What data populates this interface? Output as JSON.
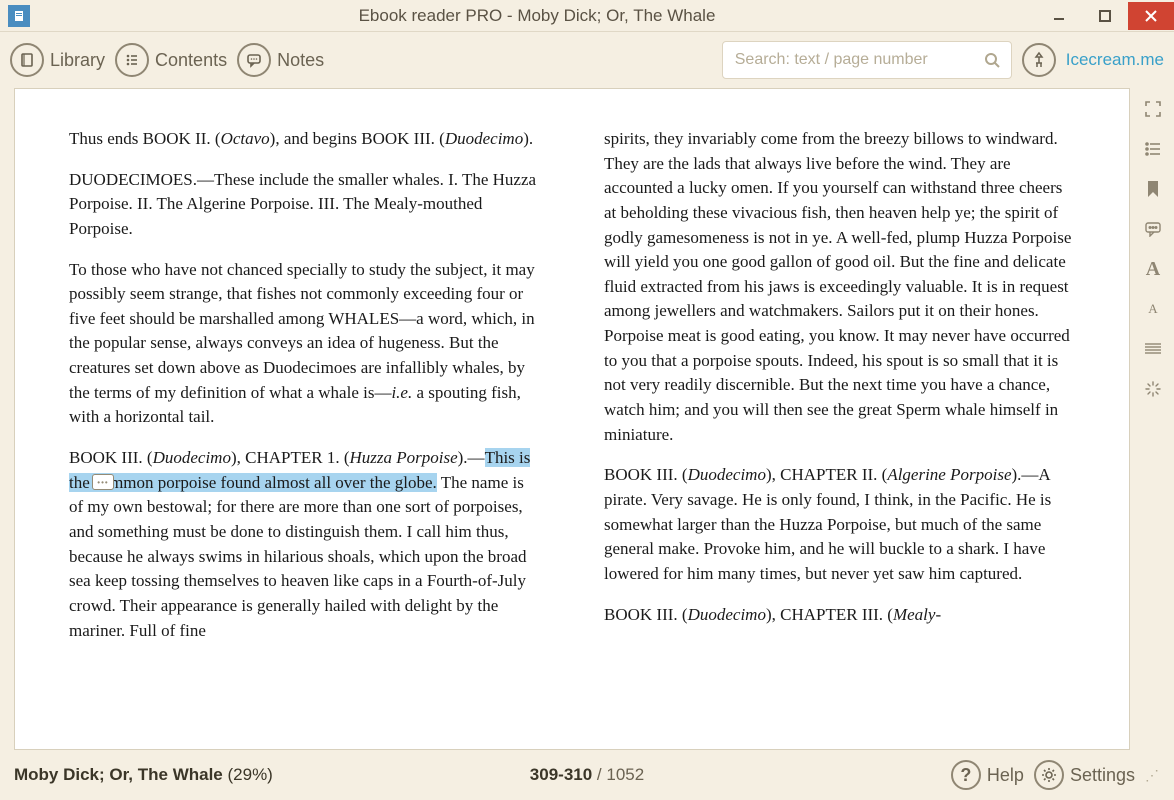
{
  "window": {
    "title": "Ebook reader PRO - Moby Dick; Or, The Whale"
  },
  "toolbar": {
    "library": "Library",
    "contents": "Contents",
    "notes": "Notes",
    "brand": "Icecream.me",
    "search_placeholder": "Search: text / page number"
  },
  "reader": {
    "left": {
      "p1a": "Thus ends BOOK II. (",
      "p1i1": "Octavo",
      "p1b": "), and begins BOOK III. (",
      "p1i2": "Duodecimo",
      "p1c": ").",
      "p2": "DUODECIMOES.—These include the smaller whales. I. The Huzza Porpoise. II. The Algerine Porpoise. III. The Mealy-mouthed Porpoise.",
      "p3a": "To those who have not chanced specially to study the subject, it may possibly seem strange, that fishes not commonly exceeding four or five feet should be marshalled among WHALES—a word, which, in the popular sense, always conveys an idea of hugeness. But the creatures set down above as Duodecimoes are infallibly whales, by the terms of my definition of what a whale is—",
      "p3i": "i.e.",
      "p3b": " a spouting fish, with a horizontal tail.",
      "p4a": "BOOK III. (",
      "p4i1": "Duodecimo",
      "p4b": "), CHAPTER 1. (",
      "p4i2": "Huzza Porpoise",
      "p4c": ").—",
      "p4hl": "This is the common porpoise found almost all over the globe.",
      "p4d": " The name is of my own bestowal; for there are more than one sort of porpoises, and something must be done to distinguish them. I call him thus, because he always swims in hilarious shoals, which upon the broad sea keep tossing themselves to heaven like caps in a Fourth-of-July crowd. Their appearance is generally hailed with delight by the mariner. Full of fine"
    },
    "right": {
      "p1": "spirits, they invariably come from the breezy billows to windward. They are the lads that always live before the wind. They are accounted a lucky omen. If you yourself can withstand three cheers at beholding these vivacious fish, then heaven help ye; the spirit of godly gamesomeness is not in ye. A well-fed, plump Huzza Porpoise will yield you one good gallon of good oil. But the fine and delicate fluid extracted from his jaws is exceedingly valuable. It is in request among jewellers and watchmakers. Sailors put it on their hones. Porpoise meat is good eating, you know. It may never have occurred to you that a porpoise spouts. Indeed, his spout is so small that it is not very readily discernible. But the next time you have a chance, watch him; and you will then see the great Sperm whale himself in miniature.",
      "p2a": "BOOK III. (",
      "p2i1": "Duodecimo",
      "p2b": "), CHAPTER II. (",
      "p2i2": "Algerine Porpoise",
      "p2c": ").—A pirate. Very savage. He is only found, I think, in the Pacific. He is somewhat larger than the Huzza Porpoise, but much of the same general make. Provoke him, and he will buckle to a shark. I have lowered for him many times, but never yet saw him captured.",
      "p3a": "BOOK III. (",
      "p3i1": "Duodecimo",
      "p3b": "), CHAPTER III. (",
      "p3i2": "Mealy-"
    }
  },
  "status": {
    "book_title": "Moby Dick; Or, The Whale",
    "progress": "(29%)",
    "page_current": "309-310",
    "page_sep": " / ",
    "page_total": "1052",
    "help": "Help",
    "settings": "Settings"
  }
}
